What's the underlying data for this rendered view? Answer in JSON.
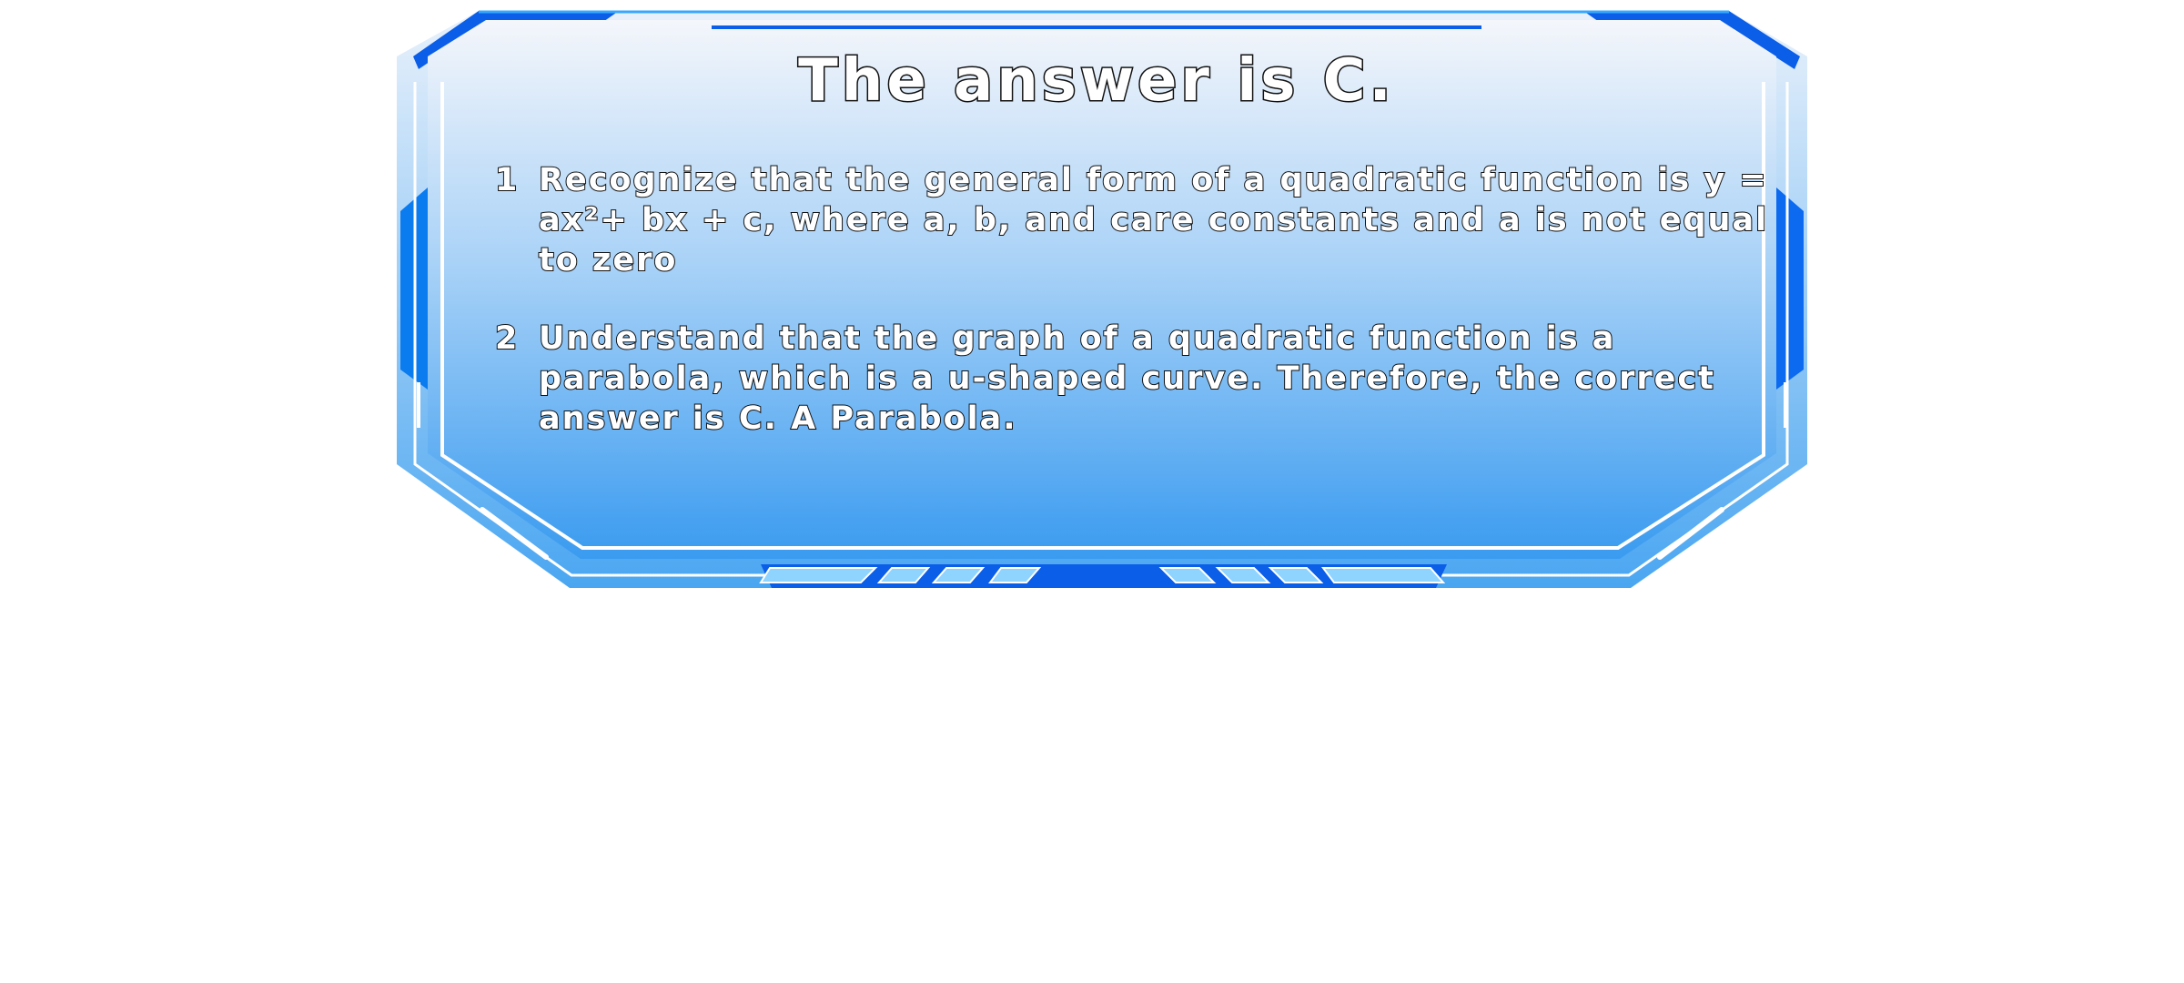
{
  "panel": {
    "title": "The answer is C.",
    "steps": [
      {
        "number": "1",
        "text": "Recognize that the general form of a quadratic function is y = ax²+ bx + c, where a, b, and care constants and a is not equal to zero"
      },
      {
        "number": "2",
        "text": "Understand that the graph of a quadratic function is a parabola, which is a u-shaped curve. Therefore, the correct answer is C. A Parabola."
      }
    ]
  },
  "colors": {
    "frame_blue": "#0a5ee8",
    "frame_light": "#8fd4ff",
    "panel_top": "#f3f6fb",
    "panel_bottom": "#3d9cef",
    "text_fill": "#ffffff",
    "text_outline": "#111111"
  }
}
